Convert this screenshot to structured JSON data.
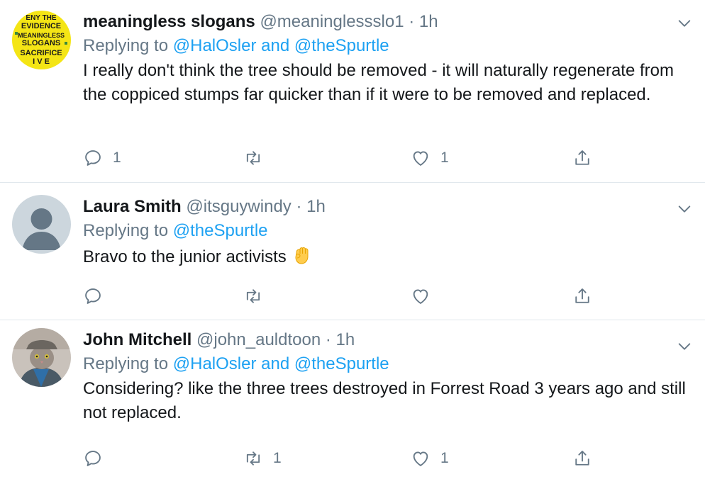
{
  "tweets": [
    {
      "name": "meaningless slogans",
      "handle": "@meaninglessslo1",
      "dot": "·",
      "time": "1h",
      "replying_prefix": "Replying to ",
      "reply_user1": "@HalOsler",
      "reply_and": " and ",
      "reply_user2": "@theSpurtle",
      "text": "I really don't think the tree should be removed - it will naturally regenerate from the coppiced stumps far quicker than if it were to be removed and replaced.",
      "reply_count": "1",
      "retweet_count": "",
      "like_count": "1",
      "avatar_lines": [
        "ENY THE",
        "EVIDENCE",
        "MEANINGLESS",
        "SLOGANS",
        "SACRIFICE",
        "I V E"
      ]
    },
    {
      "name": "Laura Smith",
      "handle": "@itsguywindy",
      "dot": "·",
      "time": "1h",
      "replying_prefix": "Replying to ",
      "reply_user1": "@theSpurtle",
      "text": "Bravo to the junior activists",
      "reply_count": "",
      "retweet_count": "",
      "like_count": ""
    },
    {
      "name": "John Mitchell",
      "handle": "@john_auldtoon",
      "dot": "·",
      "time": "1h",
      "replying_prefix": "Replying to ",
      "reply_user1": "@HalOsler",
      "reply_and": " and ",
      "reply_user2": "@theSpurtle",
      "text": "Considering? like the three trees destroyed in Forrest Road 3 years ago and still not replaced.",
      "reply_count": "",
      "retweet_count": "1",
      "like_count": "1"
    }
  ],
  "icons": {
    "reply": "reply-icon",
    "retweet": "retweet-icon",
    "like": "heart-icon",
    "share": "share-icon",
    "chevron": "chevron-down-icon",
    "emoji": "raised-fist-emoji"
  },
  "colors": {
    "link": "#1da1f2",
    "muted": "#657786",
    "text": "#14171a",
    "divider": "#e1e8ed",
    "avatar1_bg": "#f4e515"
  }
}
